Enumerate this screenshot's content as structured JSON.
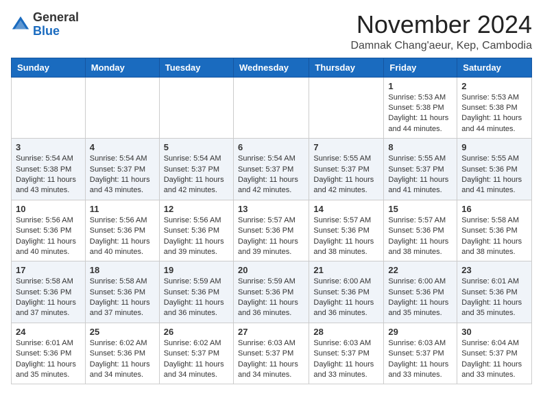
{
  "logo": {
    "general": "General",
    "blue": "Blue"
  },
  "header": {
    "month": "November 2024",
    "location": "Damnak Chang'aeur, Kep, Cambodia"
  },
  "weekdays": [
    "Sunday",
    "Monday",
    "Tuesday",
    "Wednesday",
    "Thursday",
    "Friday",
    "Saturday"
  ],
  "weeks": [
    [
      {
        "day": "",
        "info": ""
      },
      {
        "day": "",
        "info": ""
      },
      {
        "day": "",
        "info": ""
      },
      {
        "day": "",
        "info": ""
      },
      {
        "day": "",
        "info": ""
      },
      {
        "day": "1",
        "info": "Sunrise: 5:53 AM\nSunset: 5:38 PM\nDaylight: 11 hours and 44 minutes."
      },
      {
        "day": "2",
        "info": "Sunrise: 5:53 AM\nSunset: 5:38 PM\nDaylight: 11 hours and 44 minutes."
      }
    ],
    [
      {
        "day": "3",
        "info": "Sunrise: 5:54 AM\nSunset: 5:38 PM\nDaylight: 11 hours and 43 minutes."
      },
      {
        "day": "4",
        "info": "Sunrise: 5:54 AM\nSunset: 5:37 PM\nDaylight: 11 hours and 43 minutes."
      },
      {
        "day": "5",
        "info": "Sunrise: 5:54 AM\nSunset: 5:37 PM\nDaylight: 11 hours and 42 minutes."
      },
      {
        "day": "6",
        "info": "Sunrise: 5:54 AM\nSunset: 5:37 PM\nDaylight: 11 hours and 42 minutes."
      },
      {
        "day": "7",
        "info": "Sunrise: 5:55 AM\nSunset: 5:37 PM\nDaylight: 11 hours and 42 minutes."
      },
      {
        "day": "8",
        "info": "Sunrise: 5:55 AM\nSunset: 5:37 PM\nDaylight: 11 hours and 41 minutes."
      },
      {
        "day": "9",
        "info": "Sunrise: 5:55 AM\nSunset: 5:36 PM\nDaylight: 11 hours and 41 minutes."
      }
    ],
    [
      {
        "day": "10",
        "info": "Sunrise: 5:56 AM\nSunset: 5:36 PM\nDaylight: 11 hours and 40 minutes."
      },
      {
        "day": "11",
        "info": "Sunrise: 5:56 AM\nSunset: 5:36 PM\nDaylight: 11 hours and 40 minutes."
      },
      {
        "day": "12",
        "info": "Sunrise: 5:56 AM\nSunset: 5:36 PM\nDaylight: 11 hours and 39 minutes."
      },
      {
        "day": "13",
        "info": "Sunrise: 5:57 AM\nSunset: 5:36 PM\nDaylight: 11 hours and 39 minutes."
      },
      {
        "day": "14",
        "info": "Sunrise: 5:57 AM\nSunset: 5:36 PM\nDaylight: 11 hours and 38 minutes."
      },
      {
        "day": "15",
        "info": "Sunrise: 5:57 AM\nSunset: 5:36 PM\nDaylight: 11 hours and 38 minutes."
      },
      {
        "day": "16",
        "info": "Sunrise: 5:58 AM\nSunset: 5:36 PM\nDaylight: 11 hours and 38 minutes."
      }
    ],
    [
      {
        "day": "17",
        "info": "Sunrise: 5:58 AM\nSunset: 5:36 PM\nDaylight: 11 hours and 37 minutes."
      },
      {
        "day": "18",
        "info": "Sunrise: 5:58 AM\nSunset: 5:36 PM\nDaylight: 11 hours and 37 minutes."
      },
      {
        "day": "19",
        "info": "Sunrise: 5:59 AM\nSunset: 5:36 PM\nDaylight: 11 hours and 36 minutes."
      },
      {
        "day": "20",
        "info": "Sunrise: 5:59 AM\nSunset: 5:36 PM\nDaylight: 11 hours and 36 minutes."
      },
      {
        "day": "21",
        "info": "Sunrise: 6:00 AM\nSunset: 5:36 PM\nDaylight: 11 hours and 36 minutes."
      },
      {
        "day": "22",
        "info": "Sunrise: 6:00 AM\nSunset: 5:36 PM\nDaylight: 11 hours and 35 minutes."
      },
      {
        "day": "23",
        "info": "Sunrise: 6:01 AM\nSunset: 5:36 PM\nDaylight: 11 hours and 35 minutes."
      }
    ],
    [
      {
        "day": "24",
        "info": "Sunrise: 6:01 AM\nSunset: 5:36 PM\nDaylight: 11 hours and 35 minutes."
      },
      {
        "day": "25",
        "info": "Sunrise: 6:02 AM\nSunset: 5:36 PM\nDaylight: 11 hours and 34 minutes."
      },
      {
        "day": "26",
        "info": "Sunrise: 6:02 AM\nSunset: 5:37 PM\nDaylight: 11 hours and 34 minutes."
      },
      {
        "day": "27",
        "info": "Sunrise: 6:03 AM\nSunset: 5:37 PM\nDaylight: 11 hours and 34 minutes."
      },
      {
        "day": "28",
        "info": "Sunrise: 6:03 AM\nSunset: 5:37 PM\nDaylight: 11 hours and 33 minutes."
      },
      {
        "day": "29",
        "info": "Sunrise: 6:03 AM\nSunset: 5:37 PM\nDaylight: 11 hours and 33 minutes."
      },
      {
        "day": "30",
        "info": "Sunrise: 6:04 AM\nSunset: 5:37 PM\nDaylight: 11 hours and 33 minutes."
      }
    ]
  ]
}
